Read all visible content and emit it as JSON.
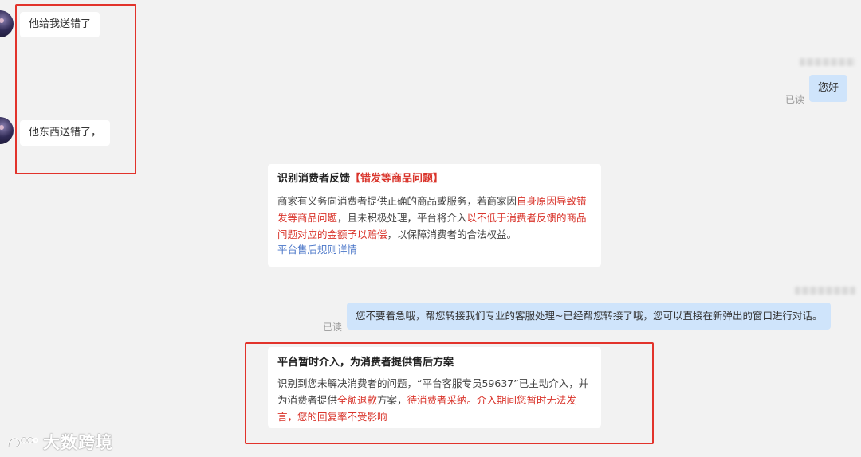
{
  "messages_left": [
    {
      "text": "他给我送错了"
    },
    {
      "text": "他东西送错了，"
    }
  ],
  "outgoing_1": {
    "text": "您好",
    "status": "已读"
  },
  "feedback_card": {
    "title_prefix": "识别消费者反馈",
    "title_tag": "【错发等商品问题】",
    "body_p1": "商家有义务向消费者提供正确的商品或服务，若商家因",
    "body_red1": "自身原因导致错发等商品问题",
    "body_p2": "，且未积极处理，平台将介入",
    "body_red2": "以不低于消费者反馈的商品问题对应的金额予以赔偿",
    "body_p3": "，以保障消费者的合法权益。",
    "link": "平台售后规则详情"
  },
  "outgoing_2": {
    "text": "您不要着急哦，帮您转接我们专业的客服处理~已经帮您转接了哦，您可以直接在新弹出的窗口进行对话。",
    "status": "已读"
  },
  "intervention_card": {
    "title": "平台暂时介入，为消费者提供售后方案",
    "body_p1": "识别到您未解决消费者的问题，“平台客服专员59637”已主动介入，并为消费者提供",
    "body_red1": "全额退款",
    "body_p2": "方案，",
    "body_red2": "待消费者采纳。介入期间您暂时无法发言，您的回复率不受影响"
  },
  "watermark": {
    "text": "大数跨境"
  },
  "colors": {
    "highlight_red": "#d9342b",
    "link_blue": "#4a76c8",
    "outgoing_bg": "#cfe4fb",
    "annotation_red": "#e2332b"
  }
}
